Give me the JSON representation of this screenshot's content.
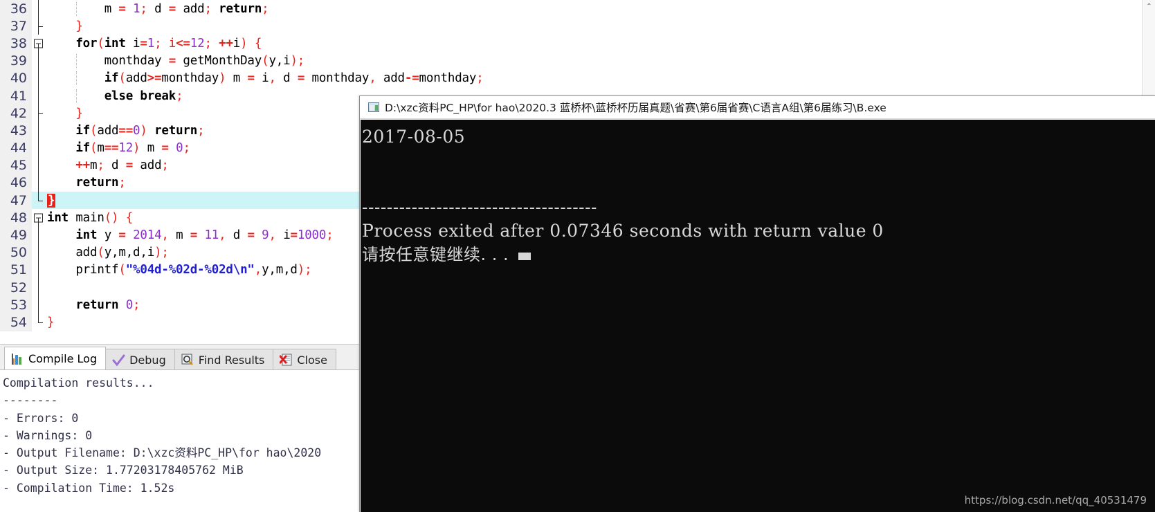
{
  "editor": {
    "lines": [
      {
        "num": "36",
        "fold": "line",
        "indent_guides": [
          1
        ],
        "text": "        m = 1; d = add; return;",
        "tokens": [
          {
            "t": "        ",
            "c": "plain"
          },
          {
            "t": "m",
            "c": "plain"
          },
          {
            "t": " ",
            "c": "plain"
          },
          {
            "t": "=",
            "c": "op"
          },
          {
            "t": " ",
            "c": "plain"
          },
          {
            "t": "1",
            "c": "num"
          },
          {
            "t": ";",
            "c": "punc"
          },
          {
            "t": " d ",
            "c": "plain"
          },
          {
            "t": "=",
            "c": "op"
          },
          {
            "t": " add",
            "c": "plain"
          },
          {
            "t": ";",
            "c": "punc"
          },
          {
            "t": " ",
            "c": "plain"
          },
          {
            "t": "return",
            "c": "kw"
          },
          {
            "t": ";",
            "c": "punc"
          }
        ]
      },
      {
        "num": "37",
        "fold": "tick",
        "indent_guides": [],
        "text": "    }",
        "tokens": [
          {
            "t": "    ",
            "c": "plain"
          },
          {
            "t": "}",
            "c": "punc"
          }
        ]
      },
      {
        "num": "38",
        "fold": "box",
        "indent_guides": [],
        "text": "    for(int i=1; i<=12; ++i) {",
        "tokens": [
          {
            "t": "    ",
            "c": "plain"
          },
          {
            "t": "for",
            "c": "kw"
          },
          {
            "t": "(",
            "c": "punc"
          },
          {
            "t": "int",
            "c": "kw"
          },
          {
            "t": " i",
            "c": "plain"
          },
          {
            "t": "=",
            "c": "op"
          },
          {
            "t": "1",
            "c": "num"
          },
          {
            "t": "; i",
            "c": "punc"
          },
          {
            "t": "<=",
            "c": "op"
          },
          {
            "t": "12",
            "c": "num"
          },
          {
            "t": "; ",
            "c": "punc"
          },
          {
            "t": "++",
            "c": "op"
          },
          {
            "t": "i",
            "c": "plain"
          },
          {
            "t": ")",
            "c": "punc"
          },
          {
            "t": " ",
            "c": "plain"
          },
          {
            "t": "{",
            "c": "punc"
          }
        ]
      },
      {
        "num": "39",
        "fold": "line",
        "indent_guides": [
          1
        ],
        "text": "        monthday = getMonthDay(y,i);",
        "tokens": [
          {
            "t": "        monthday ",
            "c": "plain"
          },
          {
            "t": "=",
            "c": "op"
          },
          {
            "t": " getMonthDay",
            "c": "plain"
          },
          {
            "t": "(",
            "c": "punc"
          },
          {
            "t": "y,i",
            "c": "plain"
          },
          {
            "t": ")",
            "c": "punc"
          },
          {
            "t": ";",
            "c": "punc"
          }
        ]
      },
      {
        "num": "40",
        "fold": "line",
        "indent_guides": [
          1
        ],
        "text": "        if(add>=monthday) m = i, d = monthday, add-=monthday;",
        "tokens": [
          {
            "t": "        ",
            "c": "plain"
          },
          {
            "t": "if",
            "c": "kw"
          },
          {
            "t": "(",
            "c": "punc"
          },
          {
            "t": "add",
            "c": "plain"
          },
          {
            "t": ">=",
            "c": "op"
          },
          {
            "t": "monthday",
            "c": "plain"
          },
          {
            "t": ")",
            "c": "punc"
          },
          {
            "t": " m ",
            "c": "plain"
          },
          {
            "t": "=",
            "c": "op"
          },
          {
            "t": " i",
            "c": "plain"
          },
          {
            "t": ",",
            "c": "punc"
          },
          {
            "t": " d ",
            "c": "plain"
          },
          {
            "t": "=",
            "c": "op"
          },
          {
            "t": " monthday",
            "c": "plain"
          },
          {
            "t": ",",
            "c": "punc"
          },
          {
            "t": " add",
            "c": "plain"
          },
          {
            "t": "-=",
            "c": "op"
          },
          {
            "t": "monthday",
            "c": "plain"
          },
          {
            "t": ";",
            "c": "punc"
          }
        ]
      },
      {
        "num": "41",
        "fold": "line",
        "indent_guides": [
          1
        ],
        "text": "        else break;",
        "tokens": [
          {
            "t": "        ",
            "c": "plain"
          },
          {
            "t": "else",
            "c": "kw"
          },
          {
            "t": " ",
            "c": "plain"
          },
          {
            "t": "break",
            "c": "kw"
          },
          {
            "t": ";",
            "c": "punc"
          }
        ]
      },
      {
        "num": "42",
        "fold": "tick",
        "indent_guides": [],
        "text": "    }",
        "tokens": [
          {
            "t": "    ",
            "c": "plain"
          },
          {
            "t": "}",
            "c": "punc"
          }
        ]
      },
      {
        "num": "43",
        "fold": "line",
        "indent_guides": [],
        "text": "    if(add==0) return;",
        "tokens": [
          {
            "t": "    ",
            "c": "plain"
          },
          {
            "t": "if",
            "c": "kw"
          },
          {
            "t": "(",
            "c": "punc"
          },
          {
            "t": "add",
            "c": "plain"
          },
          {
            "t": "==",
            "c": "op"
          },
          {
            "t": "0",
            "c": "num"
          },
          {
            "t": ")",
            "c": "punc"
          },
          {
            "t": " ",
            "c": "plain"
          },
          {
            "t": "return",
            "c": "kw"
          },
          {
            "t": ";",
            "c": "punc"
          }
        ]
      },
      {
        "num": "44",
        "fold": "line",
        "indent_guides": [],
        "text": "    if(m==12) m = 0;",
        "tokens": [
          {
            "t": "    ",
            "c": "plain"
          },
          {
            "t": "if",
            "c": "kw"
          },
          {
            "t": "(",
            "c": "punc"
          },
          {
            "t": "m",
            "c": "plain"
          },
          {
            "t": "==",
            "c": "op"
          },
          {
            "t": "12",
            "c": "num"
          },
          {
            "t": ")",
            "c": "punc"
          },
          {
            "t": " m ",
            "c": "plain"
          },
          {
            "t": "=",
            "c": "op"
          },
          {
            "t": " ",
            "c": "plain"
          },
          {
            "t": "0",
            "c": "num"
          },
          {
            "t": ";",
            "c": "punc"
          }
        ]
      },
      {
        "num": "45",
        "fold": "line",
        "indent_guides": [],
        "text": "    ++m; d = add;",
        "tokens": [
          {
            "t": "    ",
            "c": "plain"
          },
          {
            "t": "++",
            "c": "op"
          },
          {
            "t": "m",
            "c": "plain"
          },
          {
            "t": ";",
            "c": "punc"
          },
          {
            "t": " d ",
            "c": "plain"
          },
          {
            "t": "=",
            "c": "op"
          },
          {
            "t": " add",
            "c": "plain"
          },
          {
            "t": ";",
            "c": "punc"
          }
        ]
      },
      {
        "num": "46",
        "fold": "line",
        "indent_guides": [],
        "text": "    return;",
        "tokens": [
          {
            "t": "    ",
            "c": "plain"
          },
          {
            "t": "return",
            "c": "kw"
          },
          {
            "t": ";",
            "c": "punc"
          }
        ]
      },
      {
        "num": "47",
        "fold": "corner",
        "current": true,
        "indent_guides": [],
        "text": "}",
        "tokens": [
          {
            "t": "}",
            "c": "brace-hl"
          }
        ]
      },
      {
        "num": "48",
        "fold": "box",
        "indent_guides": [],
        "text": "int main() {",
        "tokens": [
          {
            "t": "int",
            "c": "kw"
          },
          {
            "t": " main",
            "c": "plain"
          },
          {
            "t": "()",
            "c": "punc"
          },
          {
            "t": " ",
            "c": "plain"
          },
          {
            "t": "{",
            "c": "punc"
          }
        ]
      },
      {
        "num": "49",
        "fold": "line",
        "indent_guides": [],
        "text": "    int y = 2014, m = 11, d = 9, i=1000;",
        "tokens": [
          {
            "t": "    ",
            "c": "plain"
          },
          {
            "t": "int",
            "c": "kw"
          },
          {
            "t": " y ",
            "c": "plain"
          },
          {
            "t": "=",
            "c": "op"
          },
          {
            "t": " ",
            "c": "plain"
          },
          {
            "t": "2014",
            "c": "num"
          },
          {
            "t": ",",
            "c": "punc"
          },
          {
            "t": " m ",
            "c": "plain"
          },
          {
            "t": "=",
            "c": "op"
          },
          {
            "t": " ",
            "c": "plain"
          },
          {
            "t": "11",
            "c": "num"
          },
          {
            "t": ",",
            "c": "punc"
          },
          {
            "t": " d ",
            "c": "plain"
          },
          {
            "t": "=",
            "c": "op"
          },
          {
            "t": " ",
            "c": "plain"
          },
          {
            "t": "9",
            "c": "num"
          },
          {
            "t": ",",
            "c": "punc"
          },
          {
            "t": " i",
            "c": "plain"
          },
          {
            "t": "=",
            "c": "op"
          },
          {
            "t": "1000",
            "c": "num"
          },
          {
            "t": ";",
            "c": "punc"
          }
        ]
      },
      {
        "num": "50",
        "fold": "line",
        "indent_guides": [],
        "text": "    add(y,m,d,i);",
        "tokens": [
          {
            "t": "    add",
            "c": "plain"
          },
          {
            "t": "(",
            "c": "punc"
          },
          {
            "t": "y,m,d,i",
            "c": "plain"
          },
          {
            "t": ")",
            "c": "punc"
          },
          {
            "t": ";",
            "c": "punc"
          }
        ]
      },
      {
        "num": "51",
        "fold": "line",
        "indent_guides": [],
        "text": "    printf(\"%04d-%02d-%02d\\n\",y,m,d);",
        "tokens": [
          {
            "t": "    printf",
            "c": "plain"
          },
          {
            "t": "(",
            "c": "punc"
          },
          {
            "t": "\"%04d-%02d-%02d\\n\"",
            "c": "str"
          },
          {
            "t": ",",
            "c": "punc"
          },
          {
            "t": "y,m,d",
            "c": "plain"
          },
          {
            "t": ")",
            "c": "punc"
          },
          {
            "t": ";",
            "c": "punc"
          }
        ]
      },
      {
        "num": "52",
        "fold": "line",
        "indent_guides": [],
        "text": "",
        "tokens": []
      },
      {
        "num": "53",
        "fold": "line",
        "indent_guides": [],
        "text": "    return 0;",
        "tokens": [
          {
            "t": "    ",
            "c": "plain"
          },
          {
            "t": "return",
            "c": "kw"
          },
          {
            "t": " ",
            "c": "plain"
          },
          {
            "t": "0",
            "c": "num"
          },
          {
            "t": ";",
            "c": "punc"
          }
        ]
      },
      {
        "num": "54",
        "fold": "corner",
        "indent_guides": [],
        "text": "}",
        "tokens": [
          {
            "t": "}",
            "c": "punc"
          }
        ]
      }
    ],
    "scroll_up_glyph": "⌃"
  },
  "bottom_panel": {
    "tabs": [
      {
        "label": "Compile Log",
        "icon": "bar-chart-icon",
        "active": true
      },
      {
        "label": "Debug",
        "icon": "checkmark-icon",
        "active": false
      },
      {
        "label": "Find Results",
        "icon": "magnifier-icon",
        "active": false
      },
      {
        "label": "Close",
        "icon": "close-document-icon",
        "active": false
      }
    ],
    "log_lines": [
      "Compilation results...",
      "--------",
      "- Errors: 0",
      "- Warnings: 0",
      "- Output Filename: D:\\xzc资料PC_HP\\for hao\\2020",
      "- Output Size: 1.77203178405762 MiB",
      "- Compilation Time: 1.52s"
    ]
  },
  "console": {
    "title": "D:\\xzc资料PC_HP\\for hao\\2020.3 蓝桥杯\\蓝桥杯历届真题\\省赛\\第6届省赛\\C语言A组\\第6届练习\\B.exe",
    "icon": "console-window-icon",
    "output_lines": [
      {
        "text": "2017-08-05",
        "lang": "latin"
      },
      {
        "text": "",
        "lang": "latin"
      },
      {
        "text": "",
        "lang": "latin"
      },
      {
        "text": "--------------------------------------",
        "lang": "latin"
      },
      {
        "text": "Process exited after 0.07346 seconds with return value 0",
        "lang": "latin"
      },
      {
        "text": "请按任意键继续. . .",
        "lang": "cn",
        "cursor": true
      }
    ]
  },
  "watermark": "https://blog.csdn.net/qq_40531479",
  "colors": {
    "current_line": "#cdf5f8",
    "console_bg": "#0b0b0b",
    "gutter_bg": "#f0f0f0",
    "keyword": "#000000",
    "number": "#8b2fc9",
    "operator": "#e8221b",
    "string": "#2020d2",
    "brace_highlight": "#e8221b"
  }
}
